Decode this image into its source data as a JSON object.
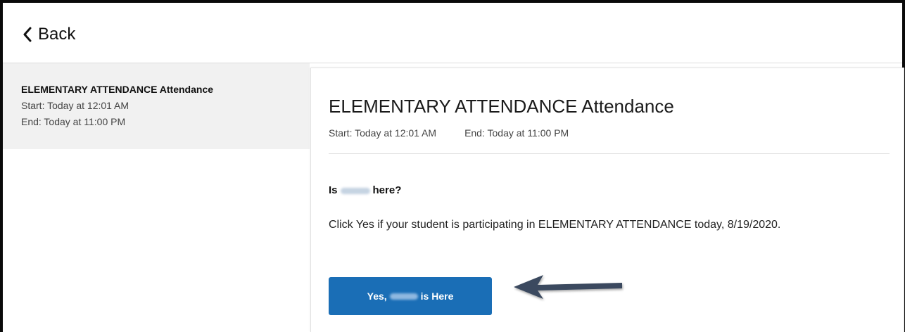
{
  "header": {
    "back_label": "Back",
    "back_icon": "chevron-left-icon"
  },
  "sidebar": {
    "items": [
      {
        "title": "ELEMENTARY ATTENDANCE Attendance",
        "start": "Start: Today at 12:01 AM",
        "end": "End: Today at 11:00 PM",
        "selected": true
      }
    ]
  },
  "detail": {
    "title": "ELEMENTARY ATTENDANCE Attendance",
    "start": "Start: Today at 12:01 AM",
    "end": "End: Today at 11:00 PM",
    "question_prefix": "Is",
    "question_suffix": "here?",
    "instruction": "Click Yes if your student is participating in ELEMENTARY ATTENDANCE today, 8/19/2020.",
    "yes_button_prefix": "Yes,",
    "yes_button_suffix": "is Here"
  },
  "colors": {
    "primary_button": "#1a6eb6",
    "annotation_arrow": "#3b4a5e",
    "sidebar_selected_bg": "#f1f1f1"
  },
  "annotation": {
    "icon": "arrow-left-icon"
  }
}
